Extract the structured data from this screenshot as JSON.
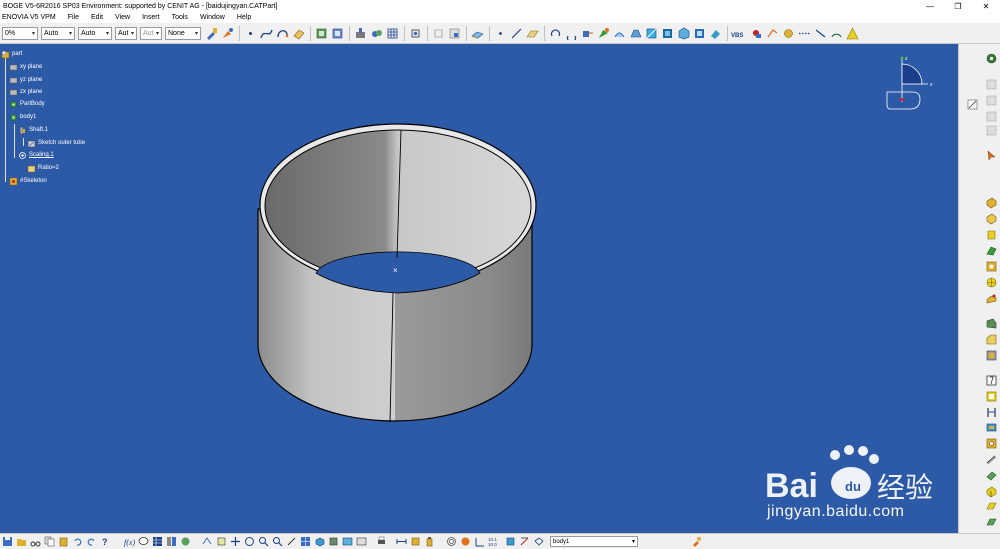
{
  "window": {
    "title": "BOGE V5-6R2016 SP03 Environment: supported by CENIT AG - [baidujingyan.CATPart]",
    "minimize_glyph": "—",
    "restore_glyph": "❐",
    "close_glyph": "✕"
  },
  "menu": [
    "ENOVIA V5 VPM",
    "File",
    "Edit",
    "View",
    "Insert",
    "Tools",
    "Window",
    "Help"
  ],
  "toolbar": {
    "combos": [
      {
        "value": "0%"
      },
      {
        "value": "Auto"
      },
      {
        "value": "Auto"
      },
      {
        "value": "Aut"
      },
      {
        "value": "Aut"
      },
      {
        "value": "None"
      }
    ]
  },
  "tree": {
    "nodes": [
      {
        "label": "part",
        "underline": false
      },
      {
        "label": "xy plane",
        "underline": false
      },
      {
        "label": "yz plane",
        "underline": false
      },
      {
        "label": "zx plane",
        "underline": false
      },
      {
        "label": "PartBody",
        "underline": false
      },
      {
        "label": "body1",
        "underline": false
      },
      {
        "label": "Shaft.1",
        "underline": false
      },
      {
        "label": "Sketch outer tube",
        "underline": false
      },
      {
        "label": "Scaling.1",
        "underline": true
      },
      {
        "label": "Ratio=2",
        "underline": false
      },
      {
        "label": "#Skeleton",
        "underline": false
      }
    ]
  },
  "compass": {
    "x_label": "x",
    "z_label": "z"
  },
  "viewport": {
    "background": "#2d5aa6",
    "center_mark": "×"
  },
  "bottom": {
    "body_combo": "body1"
  },
  "watermark": {
    "brand": "Bai经验",
    "url": "jingyan.baidu.com"
  },
  "colors": {
    "viewport_bg": "#2d5aa6",
    "tube_light": "#d6d6d6",
    "tube_dark": "#8a8a8a"
  }
}
